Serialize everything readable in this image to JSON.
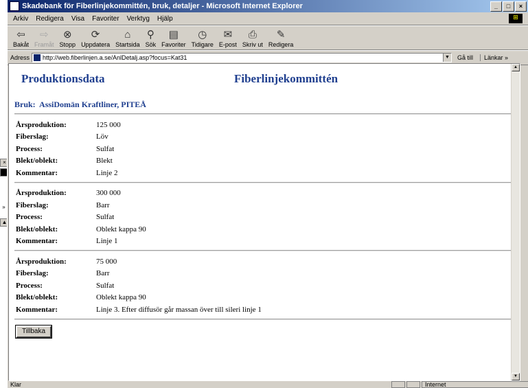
{
  "window": {
    "title": "Skadebank för Fiberlinjekommittén, bruk, detaljer - Microsoft Internet Explorer",
    "minimize_label": "_",
    "maximize_label": "□",
    "close_label": "×"
  },
  "menu": {
    "items": [
      "Arkiv",
      "Redigera",
      "Visa",
      "Favoriter",
      "Verktyg",
      "Hjälp"
    ]
  },
  "toolbar": {
    "buttons": [
      {
        "label": "Bakåt",
        "icon": "back-arrow-icon",
        "glyph": "⇦",
        "disabled": false
      },
      {
        "label": "Framåt",
        "icon": "forward-arrow-icon",
        "glyph": "⇨",
        "disabled": true
      },
      {
        "label": "Stopp",
        "icon": "stop-icon",
        "glyph": "⊗",
        "disabled": false
      },
      {
        "label": "Uppdatera",
        "icon": "refresh-icon",
        "glyph": "⟳",
        "disabled": false
      },
      {
        "label": "Startsida",
        "icon": "home-icon",
        "glyph": "⌂",
        "disabled": false
      },
      {
        "label": "Sök",
        "icon": "search-icon",
        "glyph": "⚲",
        "disabled": false
      },
      {
        "label": "Favoriter",
        "icon": "favorites-icon",
        "glyph": "▤",
        "disabled": false
      },
      {
        "label": "Tidigare",
        "icon": "history-icon",
        "glyph": "◷",
        "disabled": false
      },
      {
        "label": "E-post",
        "icon": "mail-icon",
        "glyph": "✉",
        "disabled": false
      },
      {
        "label": "Skriv ut",
        "icon": "print-icon",
        "glyph": "⎙",
        "disabled": false
      },
      {
        "label": "Redigera",
        "icon": "edit-icon",
        "glyph": "✎",
        "disabled": false
      }
    ]
  },
  "address": {
    "label": "Adress",
    "url": "http://web.fiberlinjen.a.se/AnlDetalj.asp?focus=Kat31",
    "go_label": "Gå till",
    "links_label": "Länkar »"
  },
  "page": {
    "heading_left": "Produktionsdata",
    "heading_right": "Fiberlinjekommittén",
    "bruk_label": "Bruk:",
    "bruk_value": "AssiDomän Kraftliner, PITEÅ",
    "field_labels": {
      "production": "Årsproduktion:",
      "fiber": "Fiberslag:",
      "process": "Process:",
      "bleach": "Blekt/oblekt:",
      "comment": "Kommentar:"
    },
    "records": [
      {
        "production": "125 000",
        "fiber": "Löv",
        "process": "Sulfat",
        "bleach": "Blekt",
        "comment": "Linje 2"
      },
      {
        "production": "300 000",
        "fiber": "Barr",
        "process": "Sulfat",
        "bleach": "Oblekt kappa 90",
        "comment": "Linje 1"
      },
      {
        "production": "75 000",
        "fiber": "Barr",
        "process": "Sulfat",
        "bleach": "Oblekt kappa 90",
        "comment": "Linje 3. Efter diffusör går massan över till sileri linje 1"
      }
    ],
    "back_button": "Tillbaka"
  },
  "status": {
    "text": "Klar",
    "zone": "Internet"
  },
  "colors": {
    "heading": "#1f3f8f",
    "titlebar_start": "#0a246a",
    "chrome": "#d4d0c8"
  }
}
